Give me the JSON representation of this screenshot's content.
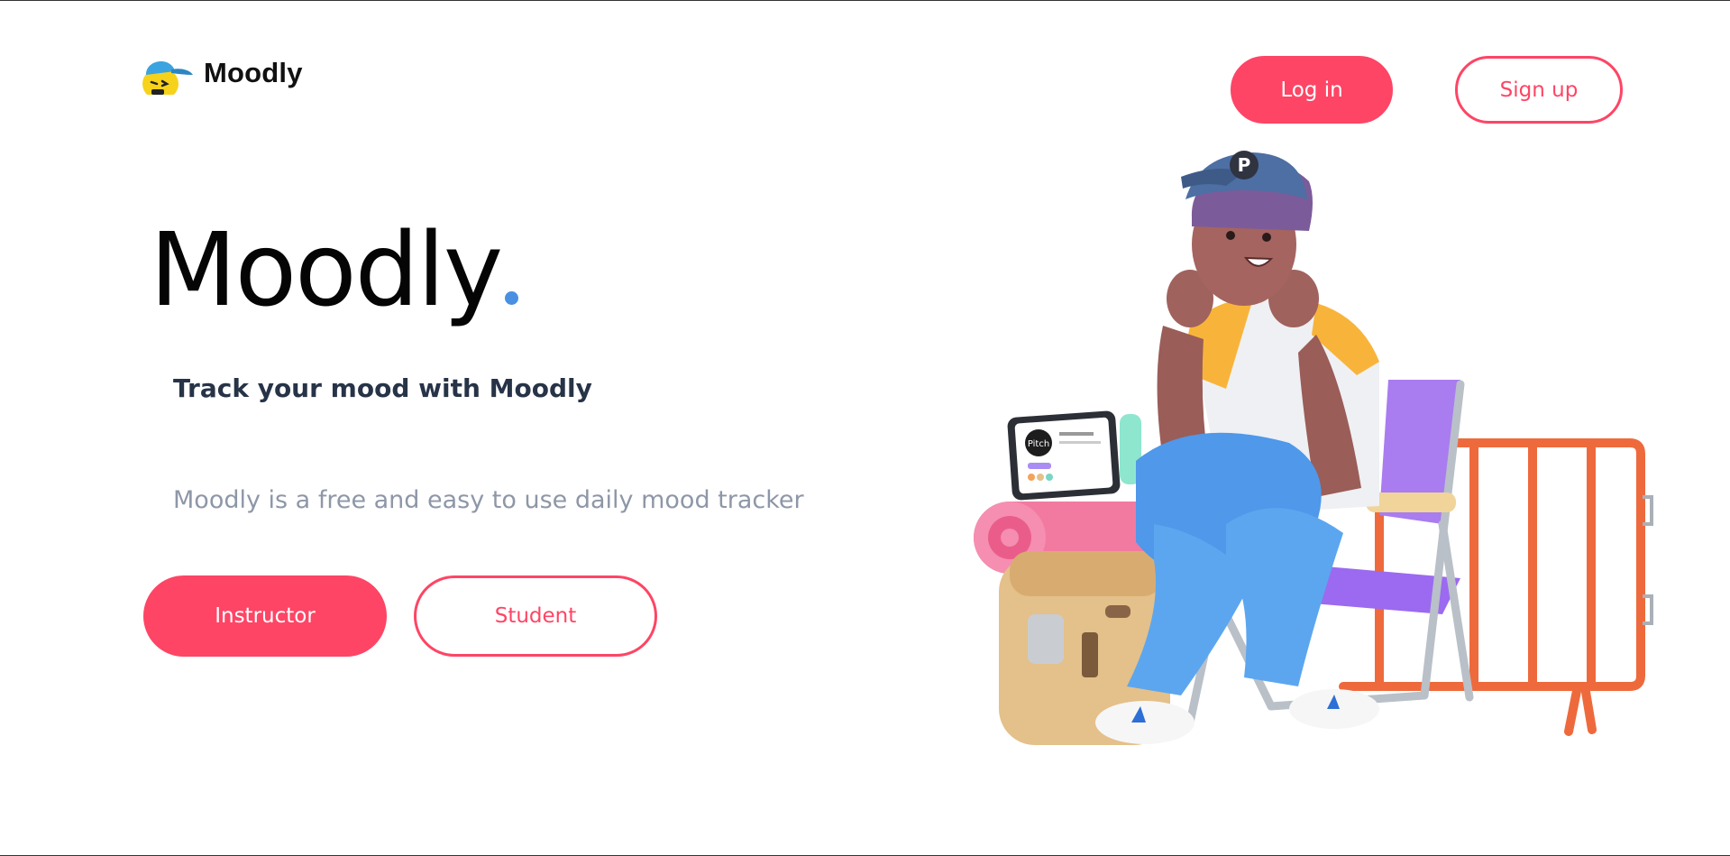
{
  "header": {
    "brand_name": "Moodly",
    "login_label": "Log in",
    "signup_label": "Sign up"
  },
  "hero": {
    "title": "Moodly",
    "subtitle": "Track your mood with Moodly",
    "description": "Moodly is a free and easy to use daily mood tracker",
    "instructor_label": "Instructor",
    "student_label": "Student"
  },
  "illustration": {
    "tablet_brand": "Pitch",
    "cap_letter": "P"
  },
  "colors": {
    "accent": "#fe4565",
    "dot": "#4a90e2",
    "subtitle": "#273347",
    "description": "#8e97a7"
  }
}
